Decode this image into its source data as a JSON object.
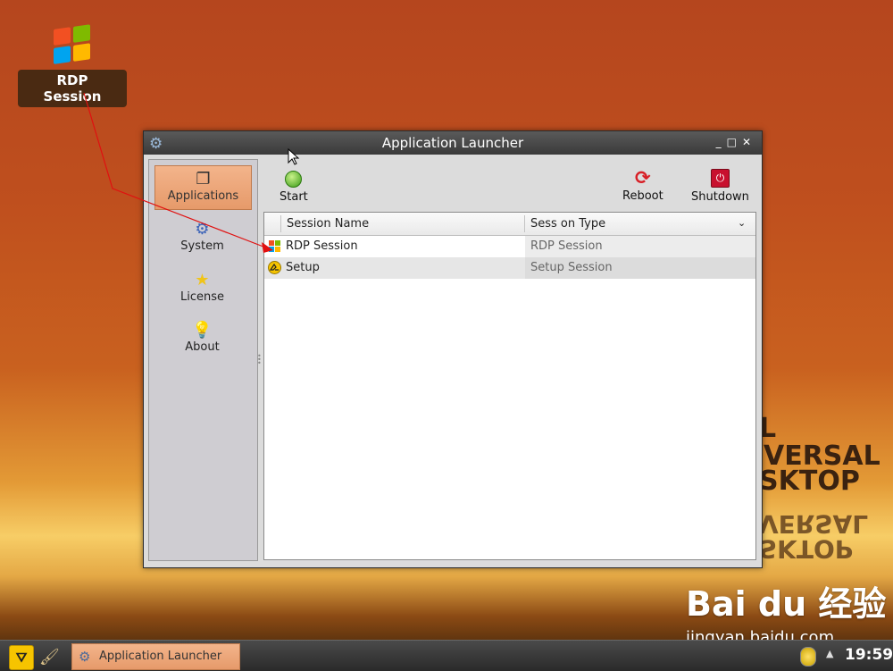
{
  "desktop": {
    "icon_label": "RDP Session",
    "watermark_lines": [
      "L",
      "VERSAL",
      "SKTOP"
    ],
    "watermark_reflection": "SKTOP VERSAL",
    "baidu_logo": "Bai du 经验",
    "baidu_url": "jingyan.baidu.com"
  },
  "window": {
    "title": "Application Launcher",
    "controls": [
      "_",
      "□",
      "✕"
    ]
  },
  "sidebar": {
    "items": [
      {
        "label": "Applications",
        "icon": "applications-icon",
        "active": true
      },
      {
        "label": "System",
        "icon": "gear-icon",
        "active": false
      },
      {
        "label": "License",
        "icon": "star-icon",
        "active": false
      },
      {
        "label": "About",
        "icon": "lightbulb-icon",
        "active": false
      }
    ]
  },
  "toolbar": {
    "start_label": "Start",
    "reboot_label": "Reboot",
    "shutdown_label": "Shutdown"
  },
  "table": {
    "columns": [
      "Session Name",
      "Sess on Type"
    ],
    "sort_indicator": "⌄",
    "rows": [
      {
        "name": "RDP Session",
        "type": "RDP Session",
        "icon": "windows-icon"
      },
      {
        "name": "Setup",
        "type": "Setup Session",
        "icon": "setup-icon"
      }
    ]
  },
  "taskbar": {
    "task_label": "Application Launcher",
    "clock": "19:59"
  },
  "colors": {
    "accent": "#e69a6a",
    "annotation": "#e01010"
  }
}
